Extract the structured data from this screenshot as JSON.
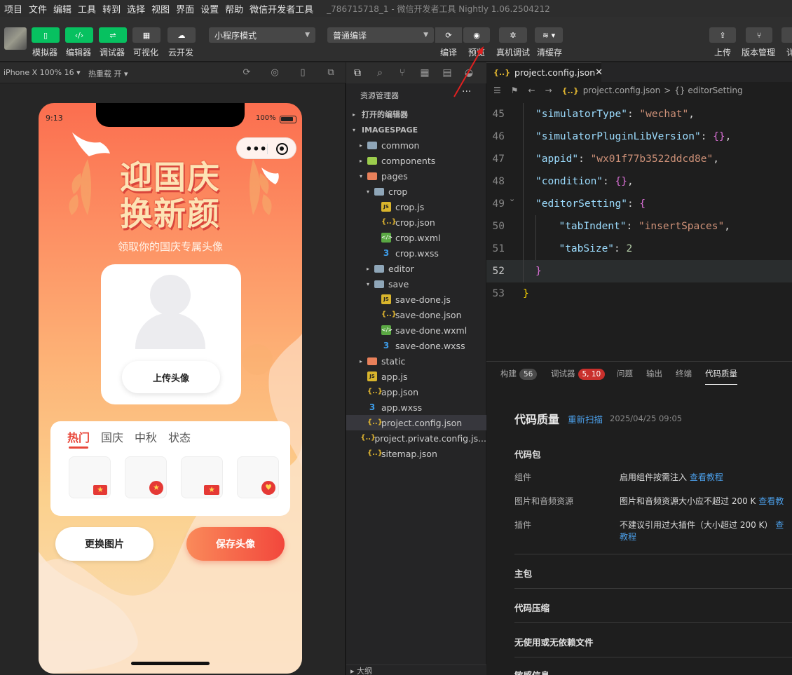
{
  "menu": {
    "items": [
      "项目",
      "文件",
      "编辑",
      "工具",
      "转到",
      "选择",
      "视图",
      "界面",
      "设置",
      "帮助",
      "微信开发者工具"
    ],
    "window_title": "_786715718_1 - 微信开发者工具 Nightly 1.06.2504212"
  },
  "toolbar": {
    "simulator": "模拟器",
    "editor": "编辑器",
    "debugger": "调试器",
    "visual": "可视化",
    "cloud": "云开发",
    "mode_select": "小程序模式",
    "compile_select": "普通编译",
    "compile": "编译",
    "preview": "预览",
    "remote_debug": "真机调试",
    "clear_cache": "清缓存",
    "upload": "上传",
    "version": "版本管理",
    "more_clip": "详"
  },
  "simbar": {
    "device": "iPhone X 100% 16 ▾",
    "hot_reload": "热重载 开 ▾"
  },
  "phone": {
    "time": "9:13",
    "battery": "100%",
    "headline_1": "迎国庆",
    "headline_2": "换新颜",
    "subtitle": "领取你的国庆专属头像",
    "upload": "上传头像",
    "tabs": [
      "热门",
      "国庆",
      "中秋",
      "状态"
    ],
    "change": "更换图片",
    "save": "保存头像"
  },
  "explorer": {
    "title": "资源管理器",
    "more": "···",
    "open_editors": "打开的编辑器",
    "project": "IMAGESPAGE",
    "tree": [
      {
        "name": "common",
        "type": "folder",
        "depth": 1,
        "twisty": "▸"
      },
      {
        "name": "components",
        "type": "folder-comp",
        "depth": 1,
        "twisty": "▸"
      },
      {
        "name": "pages",
        "type": "folder-pages",
        "depth": 1,
        "twisty": "▾"
      },
      {
        "name": "crop",
        "type": "folder",
        "depth": 2,
        "twisty": "▾"
      },
      {
        "name": "crop.js",
        "type": "js",
        "depth": 3,
        "twisty": ""
      },
      {
        "name": "crop.json",
        "type": "json",
        "depth": 3,
        "twisty": ""
      },
      {
        "name": "crop.wxml",
        "type": "wxml",
        "depth": 3,
        "twisty": ""
      },
      {
        "name": "crop.wxss",
        "type": "wxss",
        "depth": 3,
        "twisty": ""
      },
      {
        "name": "editor",
        "type": "folder",
        "depth": 2,
        "twisty": "▸"
      },
      {
        "name": "save",
        "type": "folder",
        "depth": 2,
        "twisty": "▾"
      },
      {
        "name": "save-done.js",
        "type": "js",
        "depth": 3,
        "twisty": ""
      },
      {
        "name": "save-done.json",
        "type": "json",
        "depth": 3,
        "twisty": ""
      },
      {
        "name": "save-done.wxml",
        "type": "wxml",
        "depth": 3,
        "twisty": ""
      },
      {
        "name": "save-done.wxss",
        "type": "wxss",
        "depth": 3,
        "twisty": ""
      },
      {
        "name": "static",
        "type": "folder-pages",
        "depth": 1,
        "twisty": "▸"
      },
      {
        "name": "app.js",
        "type": "js",
        "depth": 1,
        "twisty": ""
      },
      {
        "name": "app.json",
        "type": "json",
        "depth": 1,
        "twisty": ""
      },
      {
        "name": "app.wxss",
        "type": "wxss",
        "depth": 1,
        "twisty": ""
      },
      {
        "name": "project.config.json",
        "type": "json",
        "depth": 1,
        "twisty": "",
        "selected": true
      },
      {
        "name": "project.private.config.js...",
        "type": "json",
        "depth": 1,
        "twisty": ""
      },
      {
        "name": "sitemap.json",
        "type": "json",
        "depth": 1,
        "twisty": ""
      }
    ],
    "outline": "大纲"
  },
  "editor": {
    "tab": "project.config.json",
    "crumb_file": "project.config.json",
    "crumb_sep": ">",
    "crumb_key": "{} editorSetting",
    "lines": [
      {
        "no": "45",
        "tokens": [
          [
            "k",
            "\"simulatorType\""
          ],
          [
            "p",
            ": "
          ],
          [
            "s",
            "\"wechat\""
          ],
          [
            "p",
            ","
          ]
        ]
      },
      {
        "no": "46",
        "tokens": [
          [
            "k",
            "\"simulatorPluginLibVersion\""
          ],
          [
            "p",
            ": "
          ],
          [
            "b",
            "{}"
          ],
          [
            "p",
            ","
          ]
        ]
      },
      {
        "no": "47",
        "tokens": [
          [
            "k",
            "\"appid\""
          ],
          [
            "p",
            ": "
          ],
          [
            "s",
            "\"wx01f77b3522ddcd8e\""
          ],
          [
            "p",
            ","
          ]
        ]
      },
      {
        "no": "48",
        "tokens": [
          [
            "k",
            "\"condition\""
          ],
          [
            "p",
            ": "
          ],
          [
            "b",
            "{}"
          ],
          [
            "p",
            ","
          ]
        ]
      },
      {
        "no": "49",
        "tokens": [
          [
            "k",
            "\"editorSetting\""
          ],
          [
            "p",
            ": "
          ],
          [
            "b",
            "{"
          ]
        ]
      },
      {
        "no": "50",
        "tokens": [
          [
            "p",
            "  "
          ],
          [
            "k",
            "\"tabIndent\""
          ],
          [
            "p",
            ": "
          ],
          [
            "s",
            "\"insertSpaces\""
          ],
          [
            "p",
            ","
          ]
        ]
      },
      {
        "no": "51",
        "tokens": [
          [
            "p",
            "  "
          ],
          [
            "k",
            "\"tabSize\""
          ],
          [
            "p",
            ": "
          ],
          [
            "n",
            "2"
          ]
        ]
      },
      {
        "no": "52",
        "tokens": [
          [
            "b",
            "}"
          ]
        ],
        "active": true
      },
      {
        "no": "53",
        "tokens": [
          [
            "y",
            "}"
          ]
        ]
      }
    ]
  },
  "panel": {
    "tabs": [
      {
        "label": "构建",
        "badge": "56",
        "badge_type": "gray"
      },
      {
        "label": "调试器",
        "badge": "5, 10",
        "badge_type": "red"
      },
      {
        "label": "问题"
      },
      {
        "label": "输出"
      },
      {
        "label": "终端"
      },
      {
        "label": "代码质量",
        "active": true
      }
    ],
    "title": "代码质量",
    "rescan": "重新扫描",
    "time": "2025/04/25 09:05",
    "package": "代码包",
    "rows": [
      {
        "key": "组件",
        "value": "启用组件按需注入",
        "link": "查看教程"
      },
      {
        "key": "图片和音频资源",
        "value": "图片和音频资源大小应不超过 200 K",
        "link": "查看教"
      },
      {
        "key": "插件",
        "value": "不建议引用过大插件（大小超过 200 K）",
        "link": "查",
        "link2": "教程"
      }
    ],
    "sections": [
      "主包",
      "代码压缩",
      "无使用或无依赖文件",
      "敏感信息"
    ]
  }
}
